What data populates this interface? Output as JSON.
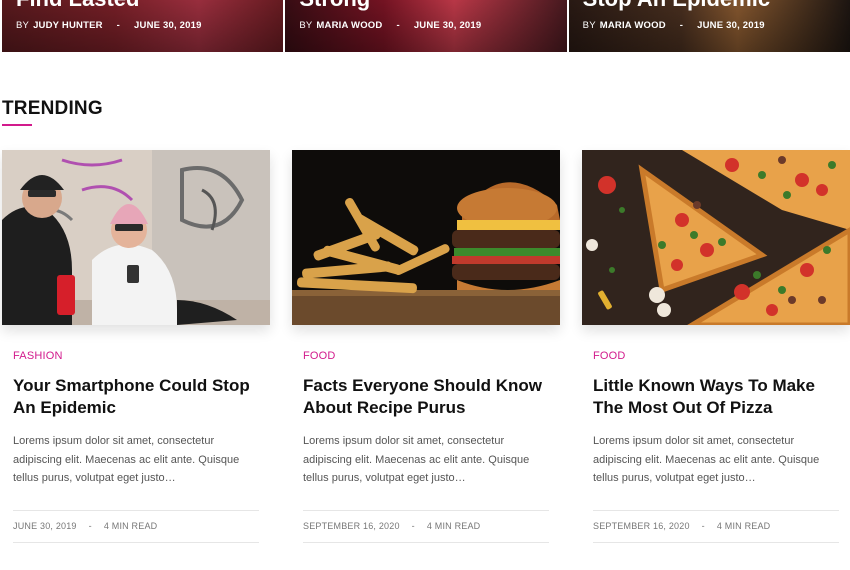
{
  "hero": [
    {
      "title_cut": "Find Lasted",
      "by": "BY",
      "author": "JUDY HUNTER",
      "date": "JUNE 30, 2019"
    },
    {
      "title_cut": "Strong",
      "by": "BY",
      "author": "MARIA WOOD",
      "date": "JUNE 30, 2019"
    },
    {
      "title_cut": "Stop An Epidemic",
      "by": "BY",
      "author": "MARIA WOOD",
      "date": "JUNE 30, 2019"
    }
  ],
  "section": {
    "title": "TRENDING"
  },
  "cards": [
    {
      "category": "FASHION",
      "title": "Your Smartphone Could Stop An Epidemic",
      "excerpt": "Lorems ipsum dolor sit amet, consectetur adipiscing elit. Maecenas ac elit ante. Quisque tellus purus, volutpat eget justo…",
      "date": "JUNE 30, 2019",
      "read": "4 MIN READ"
    },
    {
      "category": "FOOD",
      "title": "Facts Everyone Should Know About Recipe Purus",
      "excerpt": "Lorems ipsum dolor sit amet, consectetur adipiscing elit. Maecenas ac elit ante. Quisque tellus purus, volutpat eget justo…",
      "date": "SEPTEMBER 16, 2020",
      "read": "4 MIN READ"
    },
    {
      "category": "FOOD",
      "title": "Little Known Ways To Make The Most Out Of Pizza",
      "excerpt": "Lorems ipsum dolor sit amet, consectetur adipiscing elit. Maecenas ac elit ante. Quisque tellus purus, volutpat eget justo…",
      "date": "SEPTEMBER 16, 2020",
      "read": "4 MIN READ"
    }
  ],
  "colors": {
    "accent": "#d21a8c",
    "title": "#111111",
    "text": "#555555",
    "meta": "#777777"
  }
}
